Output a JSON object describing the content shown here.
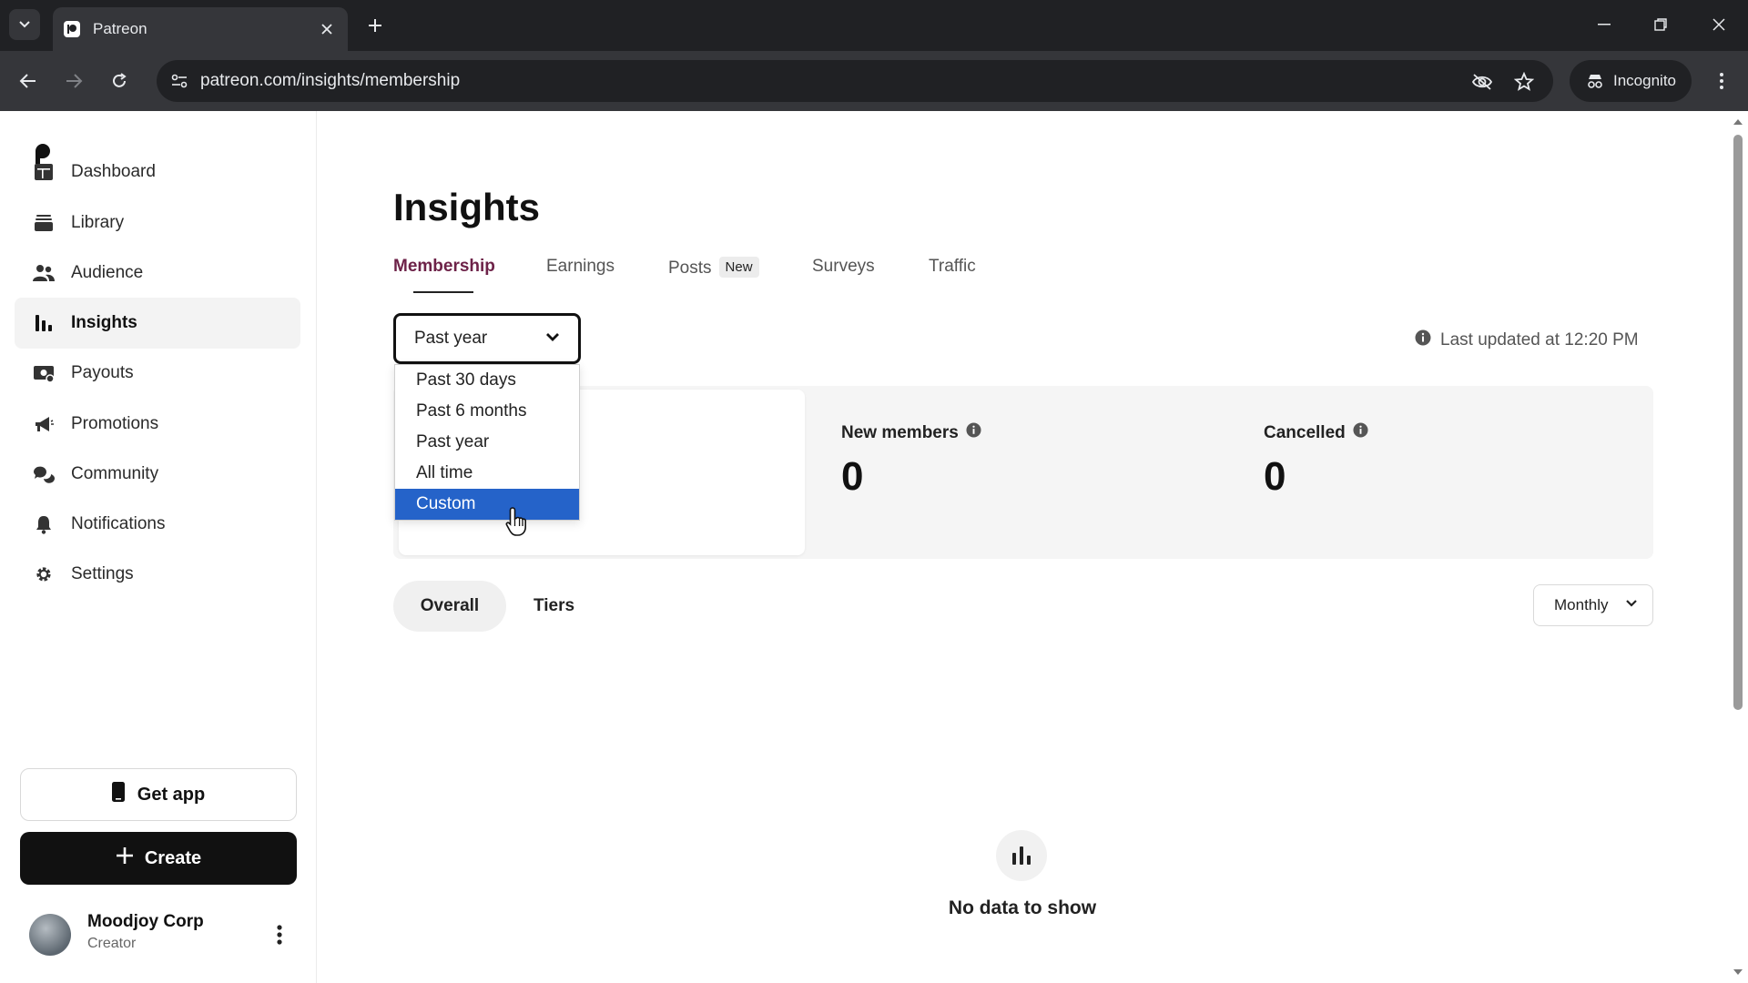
{
  "browser": {
    "tab_title": "Patreon",
    "url": "patreon.com/insights/membership",
    "incognito_label": "Incognito"
  },
  "sidebar": {
    "items": [
      {
        "label": "Dashboard",
        "icon": "dashboard-icon"
      },
      {
        "label": "Library",
        "icon": "library-icon"
      },
      {
        "label": "Audience",
        "icon": "audience-icon"
      },
      {
        "label": "Insights",
        "icon": "insights-icon",
        "active": true
      },
      {
        "label": "Payouts",
        "icon": "payouts-icon"
      },
      {
        "label": "Promotions",
        "icon": "megaphone-icon"
      },
      {
        "label": "Community",
        "icon": "chat-icon"
      },
      {
        "label": "Notifications",
        "icon": "bell-icon"
      },
      {
        "label": "Settings",
        "icon": "gear-icon"
      }
    ],
    "get_app_label": "Get app",
    "create_label": "Create",
    "profile": {
      "name": "Moodjoy Corp",
      "role": "Creator"
    }
  },
  "main": {
    "title": "Insights",
    "tabs": [
      {
        "label": "Membership",
        "active": true
      },
      {
        "label": "Earnings"
      },
      {
        "label": "Posts",
        "badge": "New"
      },
      {
        "label": "Surveys"
      },
      {
        "label": "Traffic"
      }
    ],
    "range_select": {
      "value": "Past year",
      "options": [
        "Past 30 days",
        "Past 6 months",
        "Past year",
        "All time",
        "Custom"
      ],
      "highlighted": "Custom"
    },
    "last_updated": "Last updated at 12:20 PM",
    "stats": [
      {
        "label": "New members",
        "value": "0"
      },
      {
        "label": "Cancelled",
        "value": "0"
      }
    ],
    "segments": [
      "Overall",
      "Tiers"
    ],
    "interval_select": "Monthly",
    "empty_state": "No data to show"
  },
  "colors": {
    "accent_tab": "#6d2248",
    "highlight": "#2563c9",
    "chrome_dark": "#202124",
    "chrome_toolbar": "#35363a"
  }
}
